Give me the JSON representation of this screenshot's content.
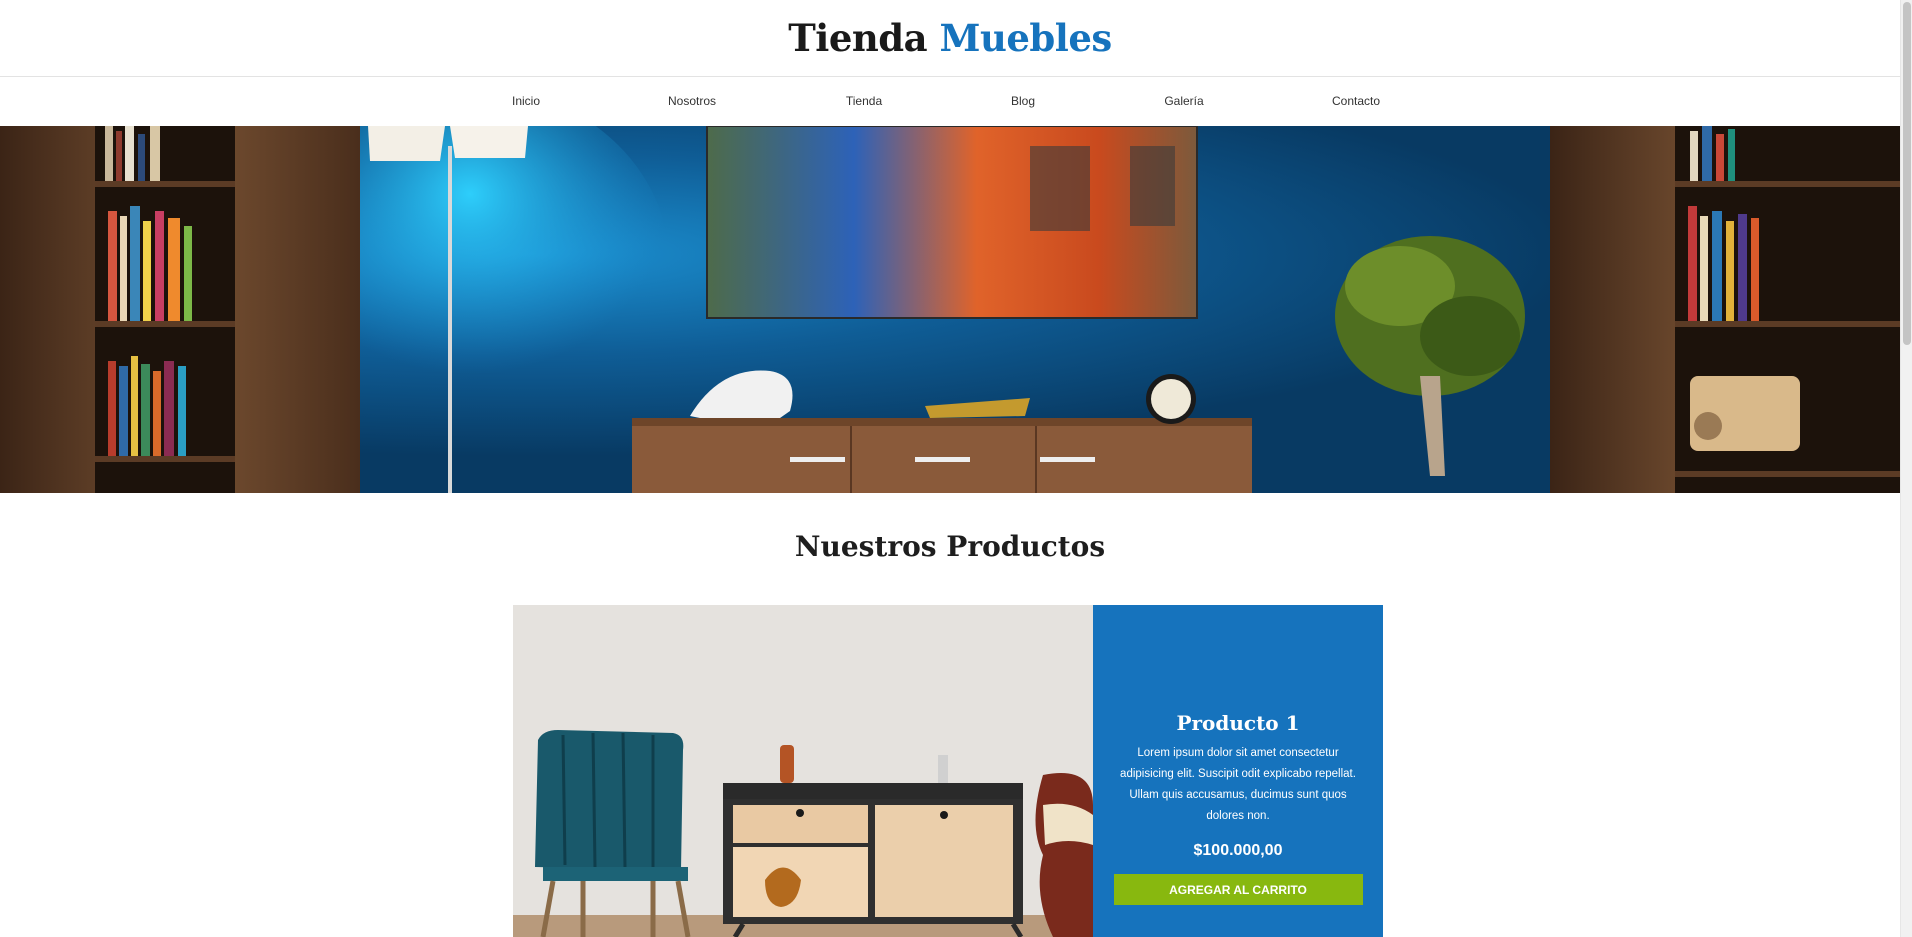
{
  "header": {
    "brand_main": "Tienda",
    "brand_accent": "Muebles"
  },
  "nav": {
    "items": [
      {
        "label": "Inicio"
      },
      {
        "label": "Nosotros"
      },
      {
        "label": "Tienda"
      },
      {
        "label": "Blog"
      },
      {
        "label": "Galería"
      },
      {
        "label": "Contacto"
      }
    ]
  },
  "hero": {
    "icon": "living-room-photo"
  },
  "products": {
    "section_title": "Nuestros Productos",
    "items": [
      {
        "name": "Producto 1",
        "description": "Lorem ipsum dolor sit amet consectetur adipisicing elit. Suscipit odit explicabo repellat. Ullam quis accusamus, ducimus sunt quos dolores non.",
        "price": "$100.000,00",
        "button_label": "AGREGAR AL CARRITO"
      }
    ]
  },
  "colors": {
    "accent": "#1673bd",
    "button": "#88b80f",
    "text": "#1a1a1a"
  }
}
